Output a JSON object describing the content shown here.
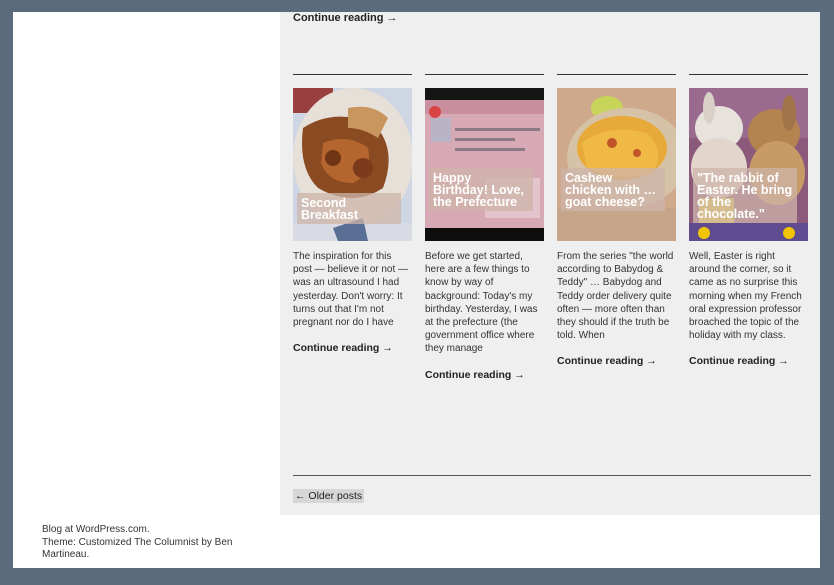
{
  "top": {
    "continue_label": "Continue reading →"
  },
  "posts": [
    {
      "title": "Second Breakfast",
      "excerpt": "The inspiration for this post — believe it or not — was an ultrasound I had yesterday. Don't worry: It turns out that I'm not pregnant nor do I have",
      "continue_label": "Continue reading →"
    },
    {
      "title": "Happy Birthday! Love, the Prefecture",
      "excerpt": "Before we get started, here are a few things to know by way of background: Today's my birthday. Yesterday, I was at the prefecture (the government office where they manage",
      "continue_label": "Continue reading →"
    },
    {
      "title": "Cashew chicken with … goat cheese?",
      "excerpt": "From the series \"the world according to Babydog & Teddy\" … Babydog and Teddy order delivery quite often — more often than they should if the truth be told. When",
      "continue_label": "Continue reading →"
    },
    {
      "title": "\"The rabbit of Easter. He bring of the chocolate.\"",
      "excerpt": "Well, Easter is right around the corner, so it came as no surprise this morning when my French oral expression professor broached the topic of the holiday with my class.",
      "continue_label": "Continue reading →"
    }
  ],
  "pagination": {
    "older_label": "← Older posts"
  },
  "footer": {
    "line1": "Blog at WordPress.com.",
    "line2": "Theme: Customized The Columnist by Ben Martineau."
  }
}
